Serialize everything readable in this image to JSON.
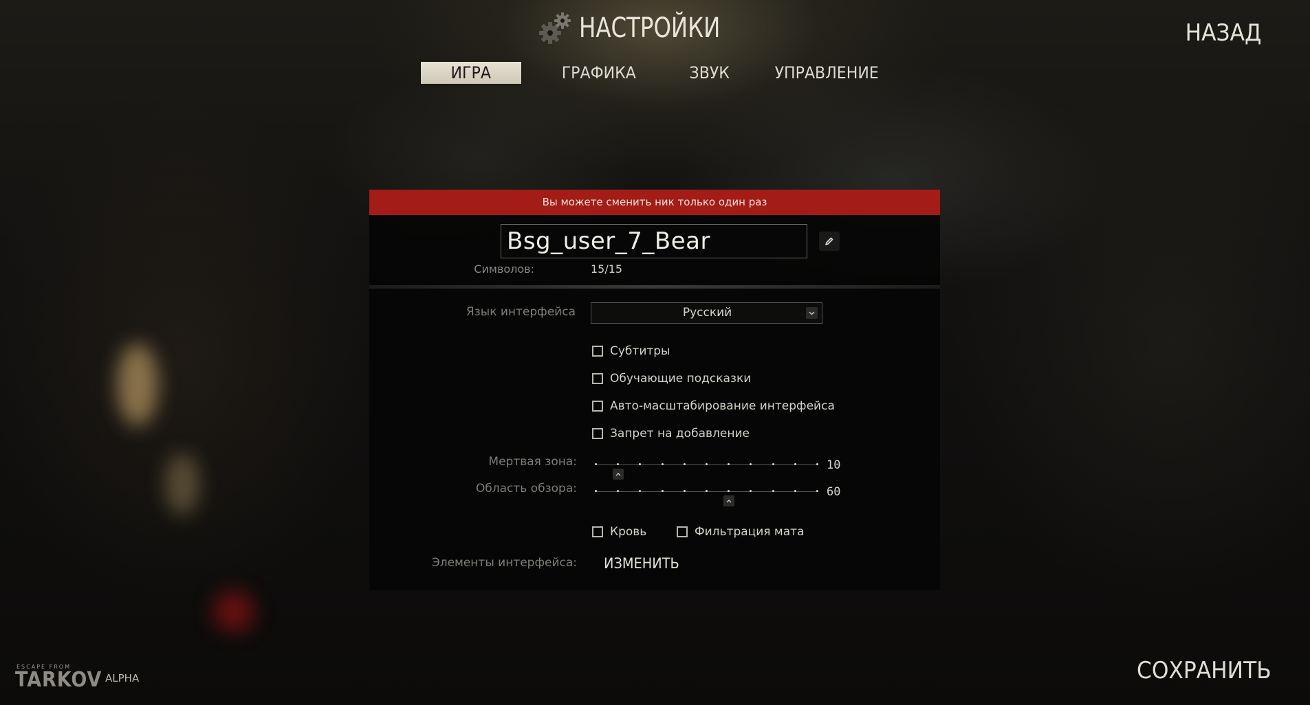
{
  "header": {
    "title": "НАСТРОЙКИ",
    "title_icon": "gears-icon",
    "back_label": "НАЗАД"
  },
  "tabs": [
    {
      "label": "ИГРА",
      "active": true
    },
    {
      "label": "ГРАФИКА",
      "active": false
    },
    {
      "label": "ЗВУК",
      "active": false
    },
    {
      "label": "УПРАВЛЕНИЕ",
      "active": false
    }
  ],
  "nickname": {
    "warning": "Вы можете сменить ник только один раз",
    "value": "Bsg_user_7_Bear",
    "edit_icon": "pencil-icon",
    "chars_label": "Символов:",
    "chars_value": "15/15"
  },
  "language": {
    "label": "Язык интерфейса",
    "selected": "Русский",
    "chevron_icon": "chevron-down-icon"
  },
  "checkboxes": [
    {
      "label": "Субтитры",
      "checked": false
    },
    {
      "label": "Обучающие подсказки",
      "checked": false
    },
    {
      "label": "Авто-масштабирование интерфейса",
      "checked": false
    },
    {
      "label": "Запрет на добавление",
      "checked": false
    }
  ],
  "sliders": {
    "deadzone": {
      "label": "Мертвая зона:",
      "value": "10",
      "min": 0,
      "max": 100,
      "position": 10
    },
    "fov": {
      "label": "Область обзора:",
      "value": "60",
      "min": 0,
      "max": 100,
      "position": 60
    }
  },
  "extra_checkboxes": {
    "blood": {
      "label": "Кровь",
      "checked": false
    },
    "profanity": {
      "label": "Фильтрация мата",
      "checked": false
    }
  },
  "ui_elements": {
    "label": "Элементы интерфейса:",
    "button": "ИЗМЕНИТЬ"
  },
  "footer": {
    "logo_top": "ESCAPE FROM",
    "logo_main": "TARKOV",
    "badge": "ALPHA",
    "save_label": "СОХРАНИТЬ"
  },
  "colors": {
    "warning_bar": "#a41c17",
    "active_tab": "#e6e1d2",
    "text": "#d4d2ca",
    "muted_label": "#7f7d77"
  }
}
